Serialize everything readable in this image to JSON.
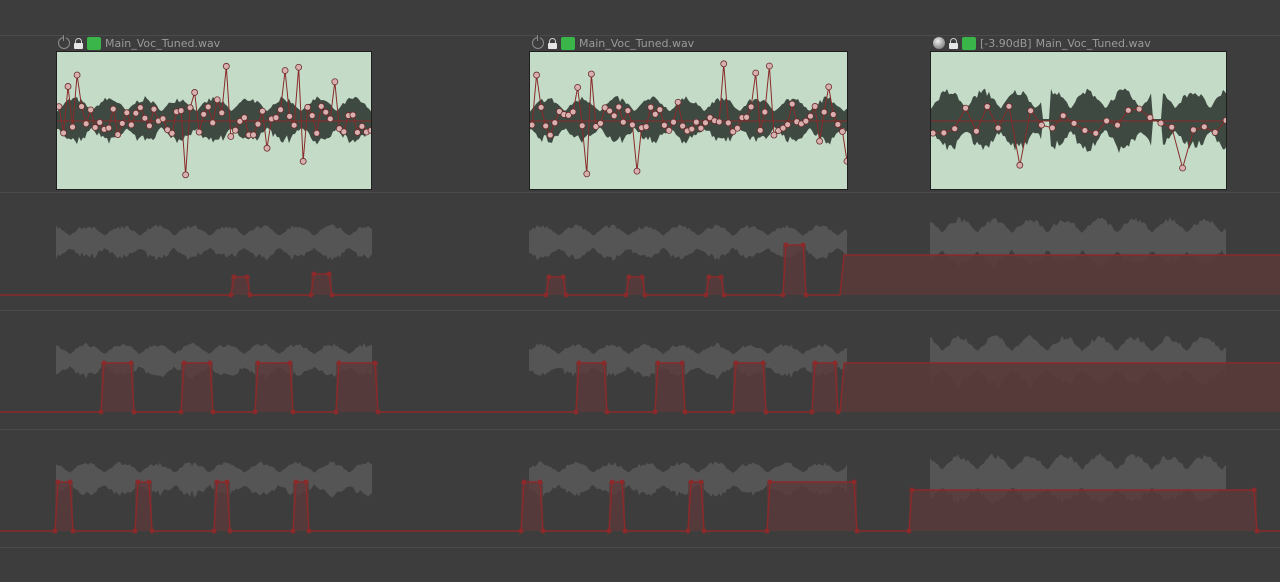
{
  "clips": [
    {
      "gain_label": "",
      "name": "Main_Voc_Tuned.wav",
      "power": "power-icon"
    },
    {
      "gain_label": "",
      "name": "Main_Voc_Tuned.wav",
      "power": "power-icon"
    },
    {
      "gain_label": "[-3.90dB]",
      "name": "Main_Voc_Tuned.wav",
      "power": "gain-knob-icon"
    }
  ],
  "colors": {
    "background": "#3d3d3d",
    "clip_fill": "#c4dcc7",
    "waveform_dark": "#3e4a41",
    "ghost_waveform": "#5d5d5d",
    "automation_line": "#8a2a2a",
    "automation_fill": "#5a3a3a",
    "pitch_node": "#d8b0b0",
    "clip_icon_green": "#39b54a"
  }
}
